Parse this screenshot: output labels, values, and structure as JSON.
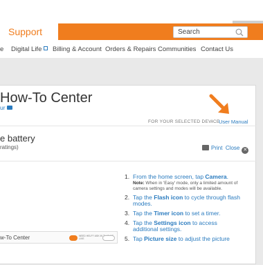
{
  "header": {
    "support_label": "Support",
    "search_placeholder": "Search"
  },
  "nav": {
    "items": [
      "e",
      "Digital Life",
      "Billing & Account",
      "Orders & Repairs",
      "Communities",
      "Contact Us"
    ]
  },
  "page": {
    "title": "How-To Center",
    "tour_link": "ur",
    "selected_device_label": "FOR YOUR SELECTED DEVICE",
    "separator": "›",
    "user_manual_label": "User Manual",
    "subtitle": "e battery",
    "ratings": "ratings)",
    "print_label": "Print",
    "close_label": "Close"
  },
  "steps": [
    {
      "num": "1.",
      "text_before": "From the home screen, tap ",
      "bold": "Camera",
      "text_after": ".",
      "note_label": "Note:",
      "note": " When in 'Easy' mode, only a limited amount of camera settings and modes will be available."
    },
    {
      "num": "2.",
      "text_before": "Tap the ",
      "bold": "Flash icon",
      "text_after": " to cycle through flash modes."
    },
    {
      "num": "3.",
      "text_before": "Tap the ",
      "bold": "Timer icon",
      "text_after": " to set a timer."
    },
    {
      "num": "4.",
      "text_before": "Tap the ",
      "bold": "Settings icon",
      "text_after": " to access additional settings."
    },
    {
      "num": "5.",
      "text_before": "Tap ",
      "bold": "Picture size",
      "text_after": " to adjust the picture"
    }
  ],
  "preview": {
    "title": "w-To Center",
    "badge_text": "NEED HELP? ASK IN TH CHAT LIVE"
  },
  "colors": {
    "brand_orange": "#f07d1e",
    "link_blue": "#2a7bbf"
  }
}
